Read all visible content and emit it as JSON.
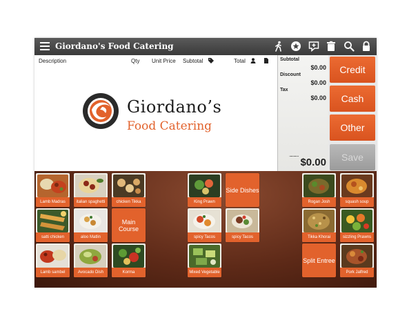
{
  "app": {
    "title": "Giordano's Food Catering"
  },
  "toolbar": {
    "icons": [
      "walk-icon",
      "star-icon",
      "comment-icon",
      "trash-icon",
      "search-icon",
      "lock-icon"
    ]
  },
  "order": {
    "columns": {
      "description": "Description",
      "qty": "Qty",
      "unit_price": "Unit Price",
      "subtotal": "Subtotal",
      "total": "Total"
    }
  },
  "logo": {
    "name": "Giordano’s",
    "subtitle": "Food Catering"
  },
  "summary": {
    "subtotal_label": "Subtotal",
    "subtotal_value": "$0.00",
    "discount_label": "Discount",
    "discount_value": "$0.00",
    "tax_label": "Tax",
    "tax_value": "$0.00",
    "dots": "...........",
    "total_value": "$0.00"
  },
  "actions": {
    "credit": "Credit",
    "cash": "Cash",
    "other": "Other",
    "save": "Save"
  },
  "colors": {
    "accent": "#e2622c",
    "titlebar": "#454545",
    "board": "#6a3320"
  },
  "menu": {
    "items": [
      "Lamb Madras",
      "italian spaghetti",
      "chicken Tikka",
      "satti chicken",
      "aloo Matlin",
      "Lamb sambel",
      "Avocado Dish",
      "Korma",
      "King Prawn",
      "spicy Tacos",
      "spicy Tacos",
      "Mixed Vegetable",
      "Rogan Josh",
      "squash soup",
      "Tikka Khorai",
      "sizzling Prawns",
      "Pork Jalfred"
    ],
    "categories": {
      "main": "Main Course",
      "side": "Side Dishes",
      "split": "Split Entree"
    }
  }
}
